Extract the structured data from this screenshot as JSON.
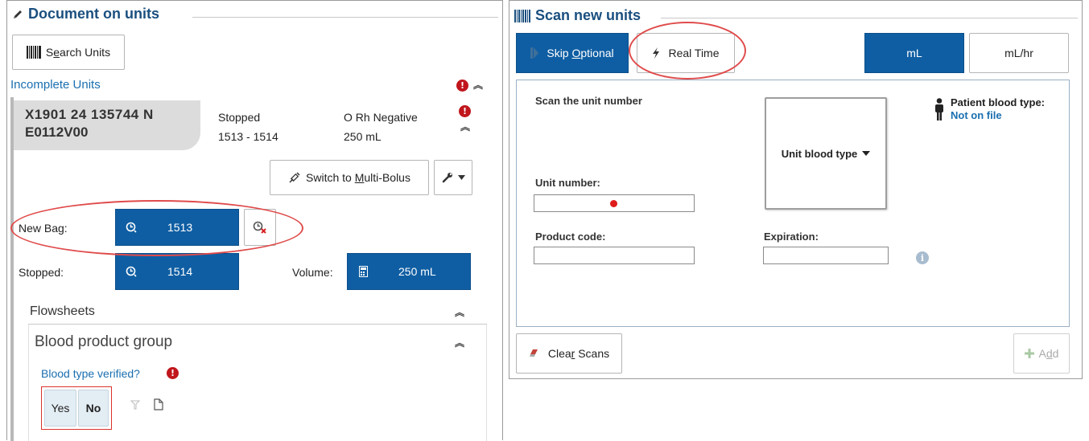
{
  "left": {
    "title": "Document on units",
    "search_button": {
      "label_pre": "S",
      "label_u": "e",
      "label_post": "arch Units"
    },
    "incomplete_units_label": "Incomplete Units",
    "unit_card": {
      "unit_number_line1": "X1901 24 135744 N",
      "unit_number_line2": "E0112V00",
      "status": "Stopped",
      "range": "1513 - 1514",
      "blood_type": "O Rh Negative",
      "volume": "250 mL"
    },
    "switch_button": {
      "label_pre": "Switch to ",
      "label_u": "M",
      "label_post": "ulti-Bolus"
    },
    "new_bag": {
      "label": "New Bag:",
      "value": "1513"
    },
    "stopped": {
      "label": "Stopped:",
      "value": "1514"
    },
    "volume": {
      "label": "Volume:",
      "value": "250 mL"
    },
    "flowsheets_label": "Flowsheets",
    "group_title": "Blood product group",
    "question": "Blood type verified?",
    "yes_label": "Yes",
    "no_label": "No"
  },
  "right": {
    "title": "Scan new units",
    "skip_button": {
      "label_pre": "Skip ",
      "label_u": "O",
      "label_post": "ptional"
    },
    "realtime_button": "Real Time",
    "unit_ml": "mL",
    "unit_mlhr": "mL/hr",
    "scan_heading": "Scan the unit number",
    "unit_blood_type_button": "Unit blood type",
    "patient_blood_type_label": "Patient blood type:",
    "patient_blood_type_value": "Not on file",
    "unit_number_label": "Unit number:",
    "product_code_label": "Product code:",
    "expiration_label": "Expiration:",
    "clear_button": {
      "label_pre": "Clea",
      "label_u": "r",
      "label_post": " Scans"
    },
    "add_button": {
      "label_pre": "A",
      "label_u": "d",
      "label_post": "d"
    }
  },
  "colors": {
    "accent_blue": "#0f5ea3",
    "title_blue": "#1a4f7f",
    "alert_red": "#c0161c",
    "highlight_red": "#e04b4b"
  }
}
